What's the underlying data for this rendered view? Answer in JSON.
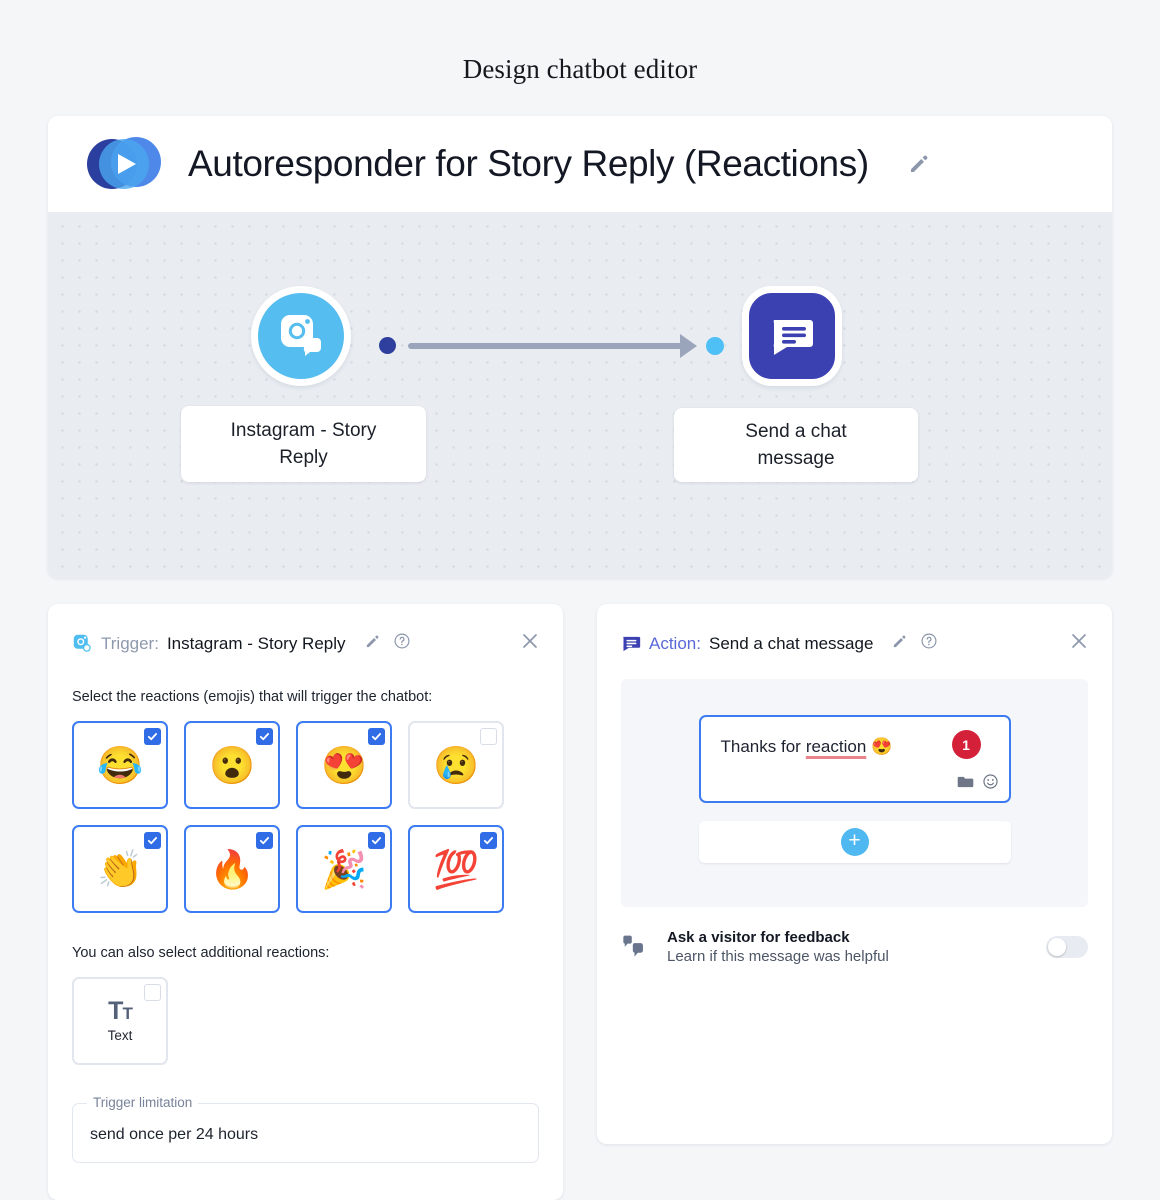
{
  "page": {
    "title": "Design chatbot editor"
  },
  "app": {
    "logo_icon": "play-circles-logo",
    "title": "Autoresponder for Story Reply (Reactions)",
    "edit_icon": "pencil-icon"
  },
  "flow": {
    "trigger_node": {
      "icon": "instagram-story-reply-icon",
      "label": "Instagram - Story\nReply",
      "label_line1": "Instagram - Story",
      "label_line2": "Reply",
      "color": "#56bdf0"
    },
    "action_node": {
      "icon": "chat-message-icon",
      "label_line1": "Send a chat",
      "label_line2": "message",
      "color": "#3b41b0"
    },
    "connector": {
      "out_dot_color": "#2f3f9e",
      "in_dot_color": "#4fc0f5",
      "line_color": "#9aa5bb"
    }
  },
  "trigger_panel": {
    "icon": "instagram-icon",
    "kind_label": "Trigger:",
    "target": "Instagram - Story Reply",
    "edit_icon": "pencil-icon",
    "help_icon": "question-circle-icon",
    "close_icon": "close-icon",
    "instruction": "Select the reactions (emojis) that will trigger the chatbot:",
    "reactions": [
      {
        "name": "face-with-tears-of-joy",
        "glyph": "😂",
        "checked": true
      },
      {
        "name": "face-with-open-mouth",
        "glyph": "😮",
        "checked": true
      },
      {
        "name": "smiling-face-with-heart-eyes",
        "glyph": "😍",
        "checked": true
      },
      {
        "name": "crying-face",
        "glyph": "😢",
        "checked": false
      },
      {
        "name": "clapping-hands",
        "glyph": "👏",
        "checked": true
      },
      {
        "name": "fire",
        "glyph": "🔥",
        "checked": true
      },
      {
        "name": "party-popper",
        "glyph": "🎉",
        "checked": true
      },
      {
        "name": "hundred-points",
        "glyph": "💯",
        "checked": true
      }
    ],
    "additional_label": "You can also select additional reactions:",
    "text_option": {
      "icon": "text-size-icon",
      "label": "Text",
      "checked": false
    },
    "limitation": {
      "legend": "Trigger limitation",
      "value": "send once per 24 hours"
    }
  },
  "action_panel": {
    "icon": "chat-message-icon",
    "kind_label": "Action:",
    "target": "Send a chat message",
    "edit_icon": "pencil-icon",
    "help_icon": "question-circle-icon",
    "close_icon": "close-icon",
    "message": {
      "text_before": "Thanks for",
      "misspelled_word": "reaction",
      "emoji": "😍",
      "badge_count": "1",
      "folder_icon": "folder-icon",
      "emoji_icon": "smiley-icon"
    },
    "add_button": {
      "icon": "plus-icon",
      "label": "+"
    },
    "feedback": {
      "icon": "thumbs-up-down-icon",
      "title": "Ask a visitor for feedback",
      "subtitle": "Learn if this message was helpful",
      "enabled": false
    }
  }
}
